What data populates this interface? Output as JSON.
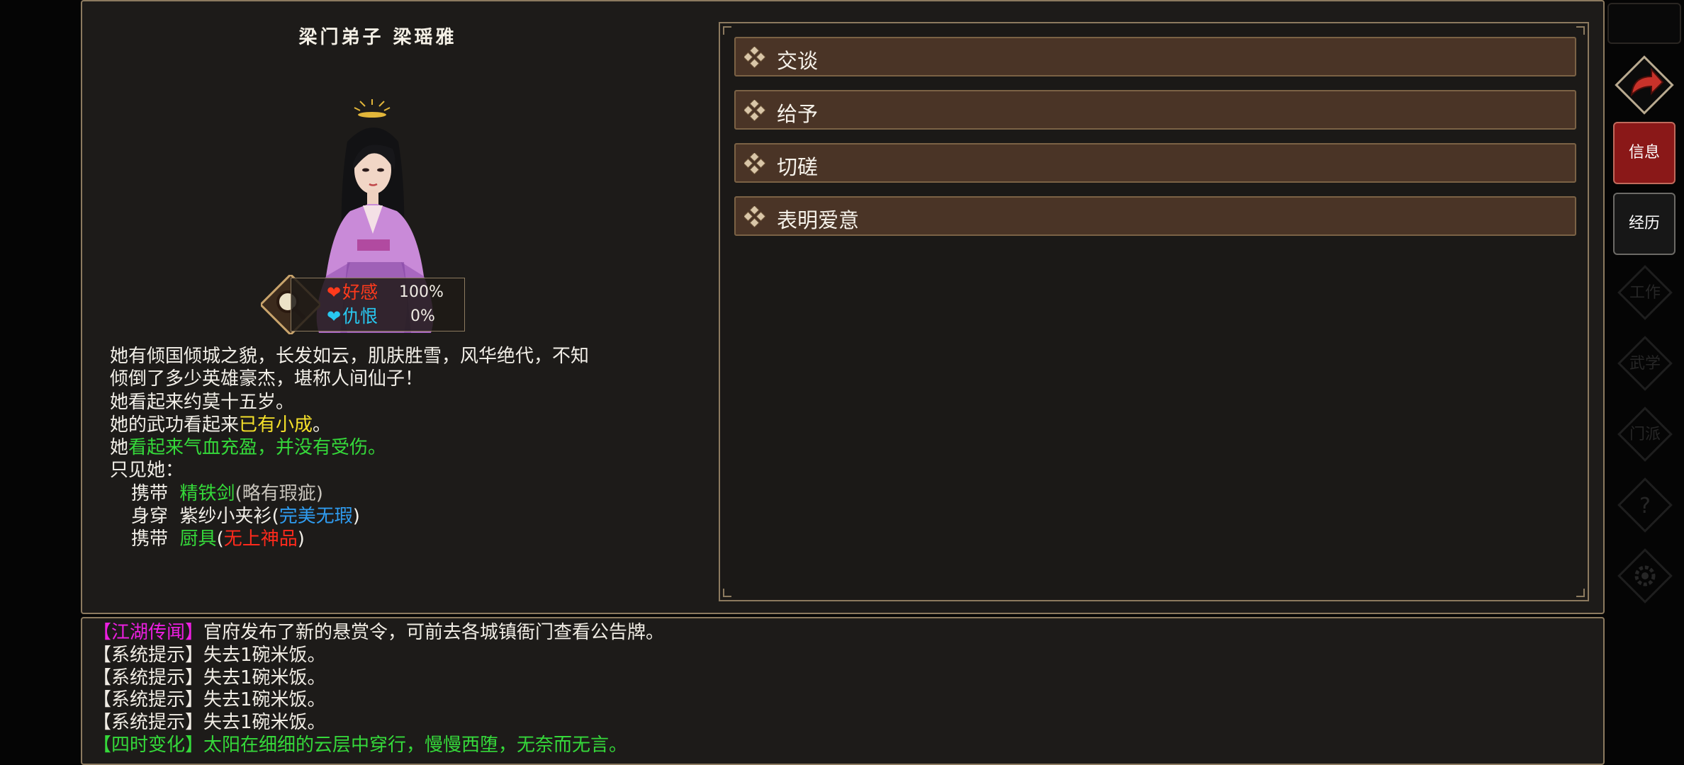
{
  "npc": {
    "title": "梁门弟子 梁瑶雅",
    "relations": [
      {
        "label": "好感",
        "value": "100%",
        "color": "#ff3a1c",
        "icon": "heart-icon"
      },
      {
        "label": "仇恨",
        "value": "0%",
        "color": "#28c8f0",
        "icon": "heart-icon"
      }
    ]
  },
  "description": {
    "line1": "她有倾国倾城之貌，长发如云，肌肤胜雪，风华绝代，不知",
    "line2": "倾倒了多少英雄豪杰，堪称人间仙子！",
    "line3": "她看起来约莫十五岁。",
    "line4_prefix": "她的武功看起来",
    "line4_level": "已有小成",
    "line4_suffix": "。",
    "line5_prefix": "她",
    "line5_status": "看起来气血充盈，并没有受伤。",
    "line6": "只见她：",
    "items": [
      {
        "verb": "携带",
        "name": "精铁剑",
        "open": "(",
        "quality": "略有瑕疵",
        "close": ")",
        "name_color": "#35d93a",
        "quality_color": "#c8c4bc"
      },
      {
        "verb": "身穿",
        "name": "紫纱小夹衫",
        "open": "(",
        "quality": "完美无瑕",
        "close": ")",
        "name_color": "#f2efe8",
        "quality_color": "#2f9cf0"
      },
      {
        "verb": "携带",
        "name": "厨具",
        "open": "(",
        "quality": "无上神品",
        "close": ")",
        "name_color": "#35d93a",
        "quality_color": "#ff2a1c"
      }
    ]
  },
  "actions": [
    {
      "label": "交谈",
      "icon": "diamond-cluster-icon"
    },
    {
      "label": "给予",
      "icon": "diamond-cluster-icon"
    },
    {
      "label": "切磋",
      "icon": "diamond-cluster-icon"
    },
    {
      "label": "表明爱意",
      "icon": "diamond-cluster-icon"
    }
  ],
  "sidebar": {
    "back_icon": "return-arrow-icon",
    "tabs": [
      {
        "label": "信息",
        "active": true
      },
      {
        "label": "经历",
        "active": false
      }
    ],
    "disabled": [
      {
        "label": "工作",
        "icon": "work-icon"
      },
      {
        "label": "武学",
        "icon": "martial-icon"
      },
      {
        "label": "门派",
        "icon": "sect-icon"
      },
      {
        "label": "?",
        "icon": "help-icon"
      },
      {
        "label": "",
        "icon": "gear-icon"
      }
    ]
  },
  "log": [
    {
      "tag": "【江湖传闻】",
      "text": "官府发布了新的悬赏令，可前去各城镇衙门查看公告牌。",
      "tag_color": "#ec1fe0",
      "text_color": "#f2efe8"
    },
    {
      "tag": "【系统提示】",
      "text": "失去1碗米饭。",
      "tag_color": "#f2efe8",
      "text_color": "#f2efe8"
    },
    {
      "tag": "【系统提示】",
      "text": "失去1碗米饭。",
      "tag_color": "#f2efe8",
      "text_color": "#f2efe8"
    },
    {
      "tag": "【系统提示】",
      "text": "失去1碗米饭。",
      "tag_color": "#f2efe8",
      "text_color": "#f2efe8"
    },
    {
      "tag": "【系统提示】",
      "text": "失去1碗米饭。",
      "tag_color": "#f2efe8",
      "text_color": "#f2efe8"
    },
    {
      "tag": "【四时变化】",
      "text": "太阳在细细的云层中穿行，慢慢西堕，无奈而无言。",
      "tag_color": "#35d93a",
      "text_color": "#35d93a"
    }
  ]
}
